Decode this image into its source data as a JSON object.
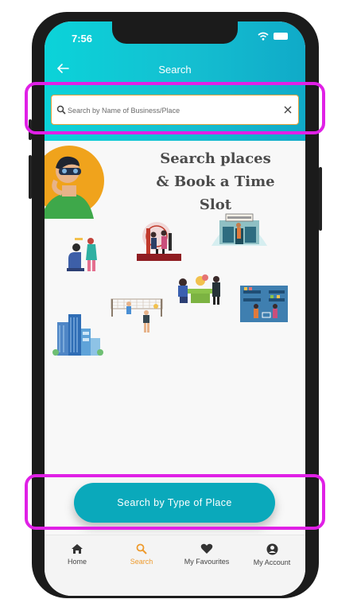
{
  "status_bar": {
    "time": "7:56"
  },
  "header": {
    "title": "Search"
  },
  "search": {
    "placeholder": "Search by Name of Business/Place"
  },
  "headline": {
    "line1": "Search places",
    "line2": "& Book a Time Slot"
  },
  "cta": {
    "label": "Search by Type of Place"
  },
  "bottom_nav": {
    "items": [
      {
        "label": "Home",
        "icon": "home-icon"
      },
      {
        "label": "Search",
        "icon": "search-icon",
        "active": true
      },
      {
        "label": "My Favourites",
        "icon": "heart-icon"
      },
      {
        "label": "My Account",
        "icon": "account-icon"
      }
    ]
  },
  "colors": {
    "header_gradient_start": "#0bd3d9",
    "header_gradient_end": "#10aac8",
    "cta": "#0aa9bb",
    "active_nav": "#ee9a2c",
    "highlight": "#e020e6",
    "search_border": "#e9a23a"
  }
}
